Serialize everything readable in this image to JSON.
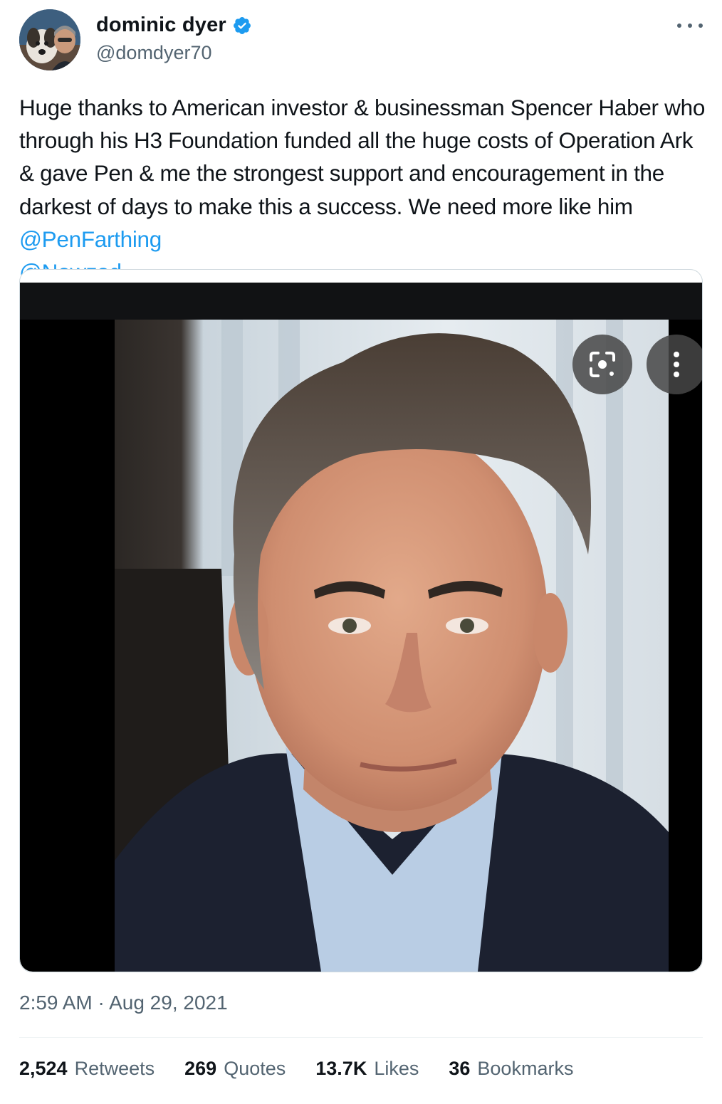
{
  "author": {
    "display_name": "dominic dyer",
    "handle": "@domdyer70",
    "verified": true,
    "avatar_icon": "profile-photo-dog-and-man"
  },
  "tweet": {
    "text_plain": "Huge thanks to American investor & businessman Spencer Haber who through his H3 Foundation funded all the huge costs of Operation Ark & gave Pen & me the strongest support and encouragement in the darkest of days to make this a success. We need more like him ",
    "mentions": [
      "@PenFarthing",
      "@Nowzad"
    ]
  },
  "media": {
    "type": "photo",
    "overlay_buttons": [
      "lens-icon",
      "more-vertical-icon"
    ]
  },
  "timestamp": "2:59 AM · Aug 29, 2021",
  "stats": [
    {
      "count": "2,524",
      "label": "Retweets"
    },
    {
      "count": "269",
      "label": "Quotes"
    },
    {
      "count": "13.7K",
      "label": "Likes"
    },
    {
      "count": "36",
      "label": "Bookmarks"
    }
  ],
  "colors": {
    "text": "#0f1419",
    "secondary": "#536471",
    "link": "#1d9bf0",
    "verified": "#1d9bf0",
    "border": "#cfd9de"
  }
}
